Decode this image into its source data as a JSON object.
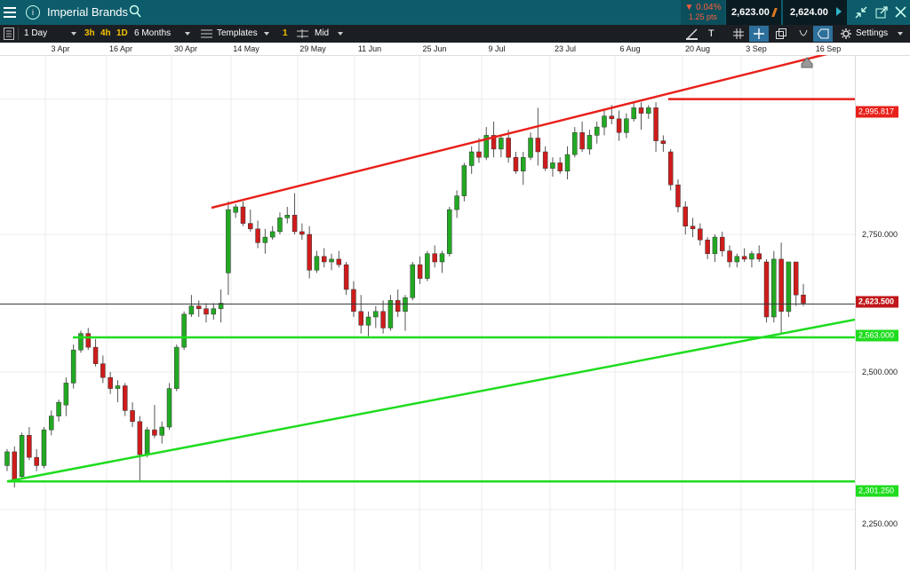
{
  "header": {
    "instrument": "Imperial Brands",
    "change_percent": "▼ 0.04%",
    "change_points": "1.25 pts",
    "sell_price": "2,623.00",
    "buy_price": "2,624.00"
  },
  "toolbar": {
    "interval": "1 Day",
    "quick_intervals": [
      "3h",
      "4h",
      "1D"
    ],
    "range": "6 Months",
    "templates": "Templates",
    "chart_count": "1",
    "price_type": "Mid",
    "settings": "Settings",
    "text_tool": "T"
  },
  "colors": {
    "up": "#22a922",
    "down": "#cf1c1c",
    "resistance": "#e8201a",
    "support": "#1fdc1f",
    "accent": "#0d5c6b"
  },
  "chart_data": {
    "type": "candlestick",
    "x_labels": [
      "3 Apr",
      "16 Apr",
      "30 Apr",
      "14 May",
      "29 May",
      "11 Jun",
      "25 Jun",
      "9 Jul",
      "23 Jul",
      "6 Aug",
      "20 Aug",
      "3 Sep",
      "16 Sep"
    ],
    "y_ticks": [
      "2,750.000",
      "2,500.000",
      "2,250.000"
    ],
    "price_tags": [
      {
        "label": "2,995.817",
        "value": 2995.817,
        "color": "#e8201a"
      },
      {
        "label": "2,623.500",
        "value": 2623.5,
        "color": "#c0161a"
      },
      {
        "label": "2,563.000",
        "value": 2563,
        "color": "#1fdc1f"
      },
      {
        "label": "2,301.250",
        "value": 2301.25,
        "color": "#1fdc1f"
      }
    ],
    "current_price": 2623.5,
    "ylim": [
      2210,
      3110
    ],
    "candles": [
      [
        2330,
        2360,
        2320,
        2355
      ],
      [
        2355,
        2365,
        2290,
        2300
      ],
      [
        2310,
        2390,
        2305,
        2385
      ],
      [
        2385,
        2400,
        2340,
        2345
      ],
      [
        2345,
        2360,
        2320,
        2330
      ],
      [
        2330,
        2400,
        2325,
        2395
      ],
      [
        2395,
        2430,
        2385,
        2420
      ],
      [
        2420,
        2450,
        2410,
        2445
      ],
      [
        2440,
        2490,
        2420,
        2480
      ],
      [
        2480,
        2550,
        2470,
        2540
      ],
      [
        2540,
        2575,
        2535,
        2570
      ],
      [
        2570,
        2580,
        2540,
        2545
      ],
      [
        2545,
        2560,
        2510,
        2515
      ],
      [
        2515,
        2530,
        2480,
        2490
      ],
      [
        2490,
        2500,
        2460,
        2470
      ],
      [
        2470,
        2485,
        2445,
        2475
      ],
      [
        2475,
        2480,
        2420,
        2430
      ],
      [
        2430,
        2445,
        2400,
        2410
      ],
      [
        2410,
        2420,
        2300,
        2350
      ],
      [
        2350,
        2400,
        2345,
        2395
      ],
      [
        2395,
        2440,
        2380,
        2385
      ],
      [
        2385,
        2410,
        2370,
        2400
      ],
      [
        2400,
        2480,
        2395,
        2470
      ],
      [
        2470,
        2550,
        2465,
        2545
      ],
      [
        2545,
        2610,
        2540,
        2605
      ],
      [
        2605,
        2640,
        2600,
        2620
      ],
      [
        2620,
        2630,
        2600,
        2615
      ],
      [
        2615,
        2625,
        2590,
        2605
      ],
      [
        2605,
        2625,
        2595,
        2615
      ],
      [
        2615,
        2650,
        2590,
        2625
      ],
      [
        2680,
        2810,
        2640,
        2795
      ],
      [
        2790,
        2805,
        2780,
        2800
      ],
      [
        2800,
        2810,
        2765,
        2770
      ],
      [
        2770,
        2795,
        2755,
        2760
      ],
      [
        2760,
        2775,
        2725,
        2735
      ],
      [
        2735,
        2760,
        2715,
        2745
      ],
      [
        2745,
        2765,
        2740,
        2755
      ],
      [
        2755,
        2790,
        2750,
        2780
      ],
      [
        2780,
        2800,
        2770,
        2785
      ],
      [
        2785,
        2825,
        2750,
        2755
      ],
      [
        2755,
        2770,
        2740,
        2750
      ],
      [
        2750,
        2765,
        2670,
        2685
      ],
      [
        2685,
        2720,
        2680,
        2710
      ],
      [
        2710,
        2725,
        2690,
        2700
      ],
      [
        2700,
        2715,
        2685,
        2705
      ],
      [
        2705,
        2720,
        2690,
        2695
      ],
      [
        2695,
        2700,
        2640,
        2650
      ],
      [
        2650,
        2665,
        2600,
        2610
      ],
      [
        2610,
        2640,
        2570,
        2585
      ],
      [
        2585,
        2610,
        2565,
        2600
      ],
      [
        2600,
        2620,
        2580,
        2610
      ],
      [
        2610,
        2630,
        2570,
        2580
      ],
      [
        2580,
        2640,
        2575,
        2630
      ],
      [
        2630,
        2650,
        2600,
        2610
      ],
      [
        2610,
        2640,
        2575,
        2635
      ],
      [
        2635,
        2700,
        2630,
        2695
      ],
      [
        2695,
        2710,
        2660,
        2670
      ],
      [
        2670,
        2720,
        2665,
        2715
      ],
      [
        2715,
        2730,
        2690,
        2700
      ],
      [
        2700,
        2720,
        2680,
        2715
      ],
      [
        2715,
        2800,
        2710,
        2795
      ],
      [
        2795,
        2830,
        2780,
        2820
      ],
      [
        2820,
        2880,
        2810,
        2875
      ],
      [
        2875,
        2910,
        2860,
        2900
      ],
      [
        2900,
        2925,
        2880,
        2890
      ],
      [
        2890,
        2945,
        2885,
        2930
      ],
      [
        2930,
        2955,
        2890,
        2905
      ],
      [
        2905,
        2930,
        2890,
        2925
      ],
      [
        2925,
        2940,
        2880,
        2890
      ],
      [
        2890,
        2900,
        2860,
        2865
      ],
      [
        2865,
        2900,
        2840,
        2890
      ],
      [
        2890,
        2935,
        2885,
        2925
      ],
      [
        2925,
        2980,
        2875,
        2900
      ],
      [
        2900,
        2910,
        2865,
        2870
      ],
      [
        2870,
        2890,
        2855,
        2880
      ],
      [
        2880,
        2890,
        2860,
        2865
      ],
      [
        2865,
        2910,
        2850,
        2895
      ],
      [
        2895,
        2945,
        2890,
        2935
      ],
      [
        2935,
        2955,
        2900,
        2905
      ],
      [
        2905,
        2940,
        2895,
        2930
      ],
      [
        2930,
        2955,
        2915,
        2945
      ],
      [
        2945,
        2975,
        2930,
        2965
      ],
      [
        2965,
        2985,
        2950,
        2960
      ],
      [
        2960,
        2975,
        2920,
        2935
      ],
      [
        2935,
        2970,
        2925,
        2960
      ],
      [
        2960,
        2990,
        2955,
        2980
      ],
      [
        2980,
        2990,
        2940,
        2970
      ],
      [
        2970,
        2985,
        2960,
        2980
      ],
      [
        2980,
        2990,
        2900,
        2920
      ],
      [
        2920,
        2930,
        2900,
        2915
      ],
      [
        2900,
        2905,
        2830,
        2840
      ],
      [
        2840,
        2850,
        2790,
        2800
      ],
      [
        2800,
        2810,
        2750,
        2765
      ],
      [
        2765,
        2780,
        2745,
        2760
      ],
      [
        2760,
        2770,
        2730,
        2740
      ],
      [
        2740,
        2745,
        2705,
        2715
      ],
      [
        2715,
        2750,
        2700,
        2745
      ],
      [
        2745,
        2755,
        2710,
        2720
      ],
      [
        2720,
        2730,
        2690,
        2700
      ],
      [
        2700,
        2715,
        2690,
        2710
      ],
      [
        2710,
        2725,
        2700,
        2705
      ],
      [
        2705,
        2720,
        2690,
        2715
      ],
      [
        2715,
        2730,
        2700,
        2705
      ],
      [
        2700,
        2705,
        2590,
        2600
      ],
      [
        2600,
        2720,
        2590,
        2705
      ],
      [
        2705,
        2735,
        2570,
        2610
      ],
      [
        2610,
        2700,
        2600,
        2700
      ],
      [
        2700,
        2700,
        2620,
        2640
      ],
      [
        2640,
        2660,
        2620,
        2625
      ]
    ]
  }
}
